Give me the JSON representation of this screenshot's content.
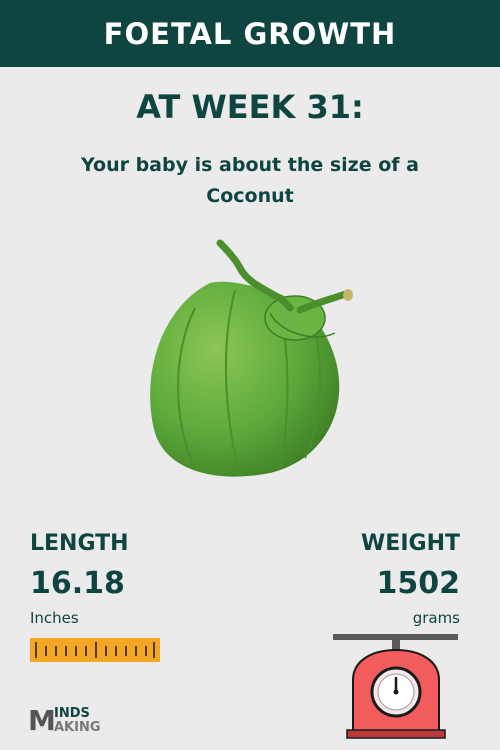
{
  "header": {
    "title": "FOETAL GROWTH"
  },
  "main": {
    "week_heading": "AT WEEK 31:",
    "size_text": "Your baby is about the size of a Coconut"
  },
  "length": {
    "label": "LENGTH",
    "value": "16.18",
    "unit": "Inches"
  },
  "weight": {
    "label": "WEIGHT",
    "value": "1502",
    "unit": "grams"
  },
  "logo": {
    "top": "INDS",
    "bottom": "AKING",
    "mark": "M"
  },
  "colors": {
    "primary": "#0f4540",
    "background": "#ebebeb",
    "coconut": "#5aa83a",
    "ruler": "#f5a623",
    "scale": "#f25c5c"
  },
  "icons": {
    "fruit": "coconut-image",
    "ruler": "ruler-icon",
    "scale": "weighing-scale-icon"
  }
}
